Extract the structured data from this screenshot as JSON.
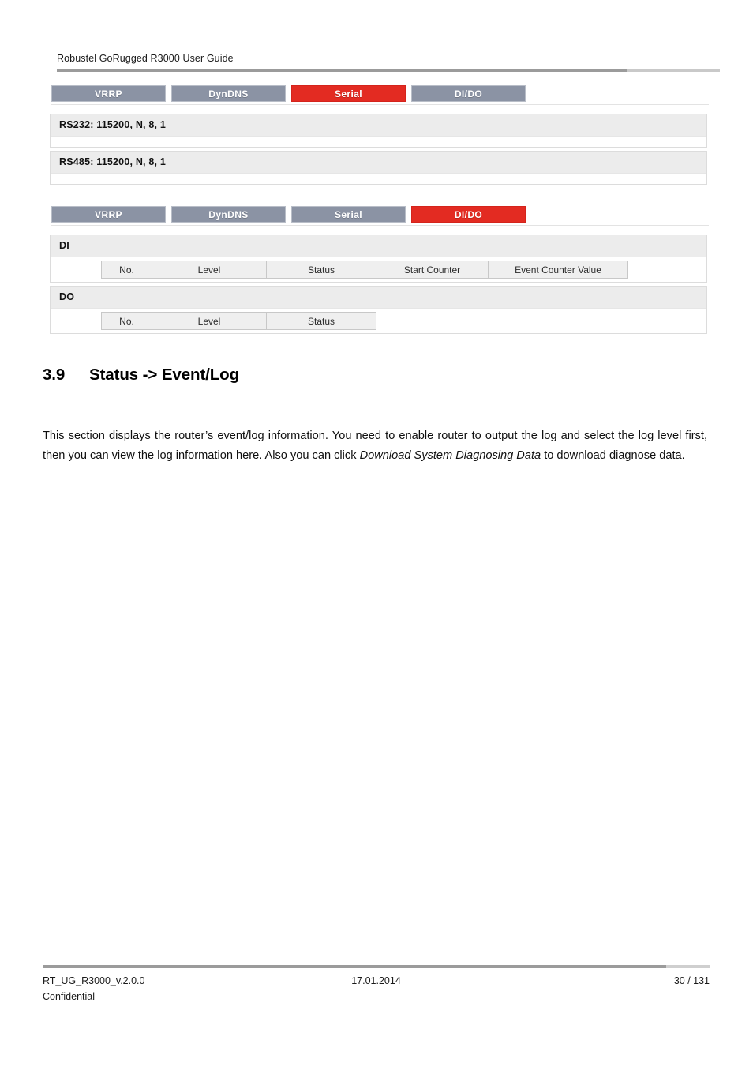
{
  "document": {
    "running_header": "Robustel GoRugged R3000 User Guide"
  },
  "screenshots": [
    {
      "name": "serial-status",
      "tabs": [
        {
          "label": "VRRP",
          "active": false
        },
        {
          "label": "DynDNS",
          "active": false
        },
        {
          "label": "Serial",
          "active": true
        },
        {
          "label": "DI/DO",
          "active": false
        }
      ],
      "panels": [
        {
          "title": "RS232: 115200, N, 8, 1"
        },
        {
          "title": "RS485: 115200, N, 8, 1"
        }
      ]
    },
    {
      "name": "dido-status",
      "tabs": [
        {
          "label": "VRRP",
          "active": false
        },
        {
          "label": "DynDNS",
          "active": false
        },
        {
          "label": "Serial",
          "active": false
        },
        {
          "label": "DI/DO",
          "active": true
        }
      ],
      "panels": [
        {
          "title": "DI",
          "columns": [
            "No.",
            "Level",
            "Status",
            "Start Counter",
            "Event Counter Value"
          ],
          "rows": []
        },
        {
          "title": "DO",
          "columns": [
            "No.",
            "Level",
            "Status"
          ],
          "rows": []
        }
      ]
    }
  ],
  "section": {
    "number": "3.9",
    "title": "Status -> Event/Log",
    "paragraph": {
      "part1": "This section displays the router’s event/log information. You need to enable router to output the log and select the log level first, then you can view the log information here. Also you can click ",
      "emphasis": "Download System Diagnosing Data",
      "part2": " to download diagnose data."
    }
  },
  "footer": {
    "doc_id": "RT_UG_R3000_v.2.0.0",
    "date": "17.01.2014",
    "page": "30 / 131",
    "classification": "Confidential"
  },
  "colors": {
    "tab_inactive": "#8b93a4",
    "tab_active": "#e32b22",
    "panel_title_bg": "#ececec",
    "rule": "#9b9b9b"
  }
}
